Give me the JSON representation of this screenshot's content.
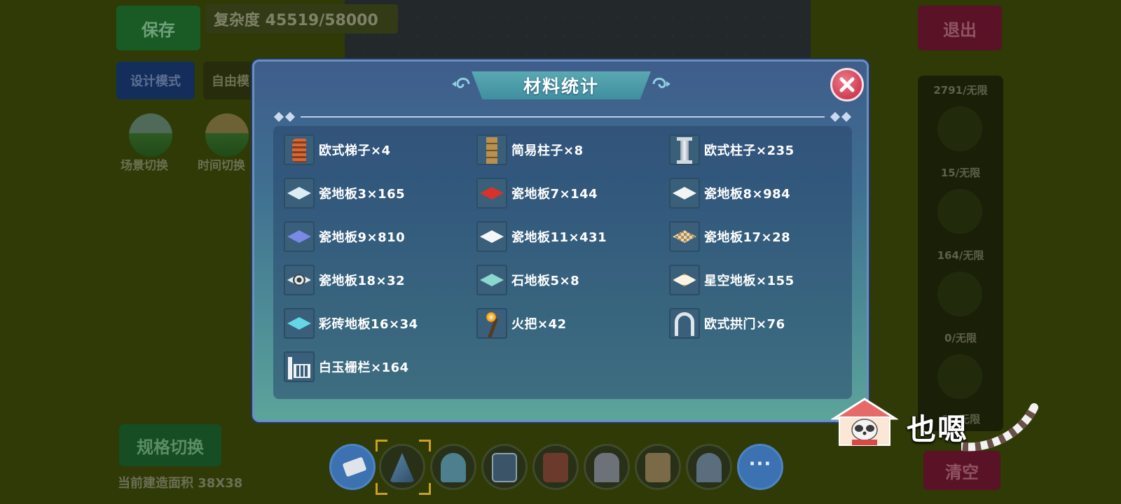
{
  "background": {
    "save_label": "保存",
    "complexity": "复杂度 45519/58000",
    "exit_label": "退出",
    "design_mode_label": "设计模式",
    "free_mode_label": "自由模",
    "scene_switch_label": "场景切换",
    "time_switch_label": "时间切换",
    "spec_switch_label": "规格切换",
    "build_area_label": "当前建造面积 38X38",
    "clear_label": "清空",
    "right_panel_counts": [
      "2791/无限",
      "15/无限",
      "164/无限",
      "0/无限",
      "61/无限"
    ]
  },
  "modal": {
    "title": "材料统计",
    "close_icon": "close-icon",
    "items": [
      {
        "label": "欧式梯子×4",
        "icon": "ladder-icon"
      },
      {
        "label": "简易柱子×8",
        "icon": "wood-pillar-icon"
      },
      {
        "label": "欧式柱子×235",
        "icon": "stone-pillar-icon"
      },
      {
        "label": "瓷地板3×165",
        "icon": "floor-tile-icon",
        "color": "#dcecf4"
      },
      {
        "label": "瓷地板7×144",
        "icon": "floor-tile-icon",
        "color": "#d8322c"
      },
      {
        "label": "瓷地板8×984",
        "icon": "floor-tile-icon",
        "color": "#f2f4f6"
      },
      {
        "label": "瓷地板9×810",
        "icon": "floor-tile-icon",
        "color": "#7a88e6"
      },
      {
        "label": "瓷地板11×431",
        "icon": "floor-tile-icon",
        "color": "#f4f6f8"
      },
      {
        "label": "瓷地板17×28",
        "icon": "floor-tile-icon",
        "color": "#b08a52"
      },
      {
        "label": "瓷地板18×32",
        "icon": "floor-tile-icon",
        "color": "#e6ecef"
      },
      {
        "label": "石地板5×8",
        "icon": "floor-tile-icon",
        "color": "#8ad8d0"
      },
      {
        "label": "星空地板×155",
        "icon": "floor-tile-icon",
        "color": "#fbf3e4"
      },
      {
        "label": "彩砖地板16×34",
        "icon": "floor-tile-icon",
        "color": "#64d6e6"
      },
      {
        "label": "火把×42",
        "icon": "torch-icon"
      },
      {
        "label": "欧式拱门×76",
        "icon": "arch-door-icon"
      },
      {
        "label": "白玉栅栏×164",
        "icon": "fence-icon"
      }
    ]
  },
  "watermark": {
    "text": "也嗯"
  },
  "colors": {
    "modal_top": "#3f5d8b",
    "modal_bottom": "#5ca49b",
    "title_bar": "#4f9fac",
    "close_button": "#cf3d55"
  }
}
